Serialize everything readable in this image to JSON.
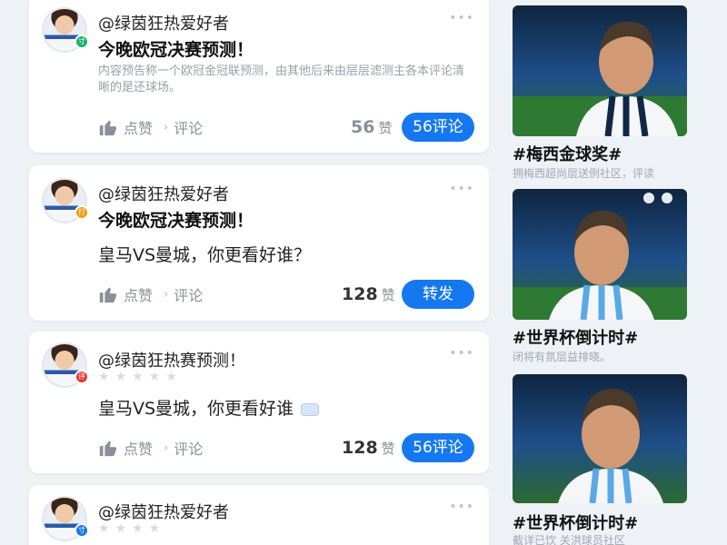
{
  "posts": [
    {
      "handle": "@绿茵狂热爱好者",
      "title": "今晚欧冠决赛预测！",
      "excerpt": "内容预告称一个欧冠金冠联预测，由其他后来由层层滤测主各本评论清晰的是还球场。",
      "like_label": "点赞",
      "comment_label": "评论",
      "count_num": "56",
      "count_unit": "赞",
      "button_label": "56评论",
      "badge_color": "#1bb36b",
      "badge_glyph": "寸"
    },
    {
      "handle": "@绿茵狂热爱好者",
      "title": "今晚欧冠决赛预测！",
      "body": "皇马VS曼城，你更看好谁？",
      "like_label": "点赞",
      "comment_label": "评论",
      "count_num": "128",
      "count_unit": "赞",
      "button_label": "转发",
      "badge_color": "#f39c12",
      "badge_glyph": "打"
    },
    {
      "handle": "@绿茵狂热赛预测！",
      "stars": "★★★★★",
      "body": "皇马VS曼城，你更看好谁",
      "like_label": "点赞",
      "comment_label": "评论",
      "count_num": "128",
      "count_unit": "赞",
      "button_label": "56评论",
      "badge_color": "#e53935",
      "badge_glyph": "评"
    },
    {
      "handle": "@绿茵狂热爱好者",
      "stars": "★★★★",
      "badge_color": "#1678f0",
      "badge_glyph": "寸"
    }
  ],
  "sidebar": [
    {
      "topic": "#梅西金球奖#",
      "sub": "拥梅西超尚层送例社区，评读"
    },
    {
      "topic": "#世界杯倒计时#",
      "sub": "闭将有氛层益排晓。"
    },
    {
      "topic": "#世界杯倒计时#",
      "sub": "截详已饮 关洪球员社区"
    }
  ],
  "more_icon": "•••"
}
